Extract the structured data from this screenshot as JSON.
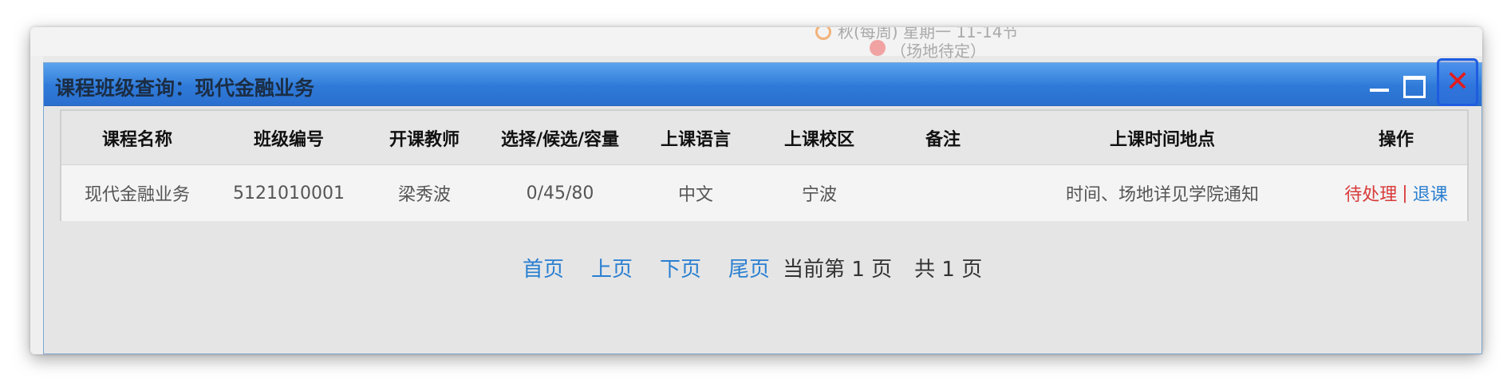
{
  "background": {
    "schedule_text": "秋(每周)  星期一  11-14节",
    "location_text": "（场地待定）"
  },
  "dialog": {
    "title": "课程班级查询：现代金融业务",
    "controls": {
      "minimize": "minimize-icon",
      "maximize": "maximize-icon",
      "close": "✕"
    }
  },
  "table": {
    "headers": [
      "课程名称",
      "班级编号",
      "开课教师",
      "选择/候选/容量",
      "上课语言",
      "上课校区",
      "备注",
      "上课时间地点",
      "操作"
    ],
    "rows": [
      {
        "course_name": "现代金融业务",
        "class_no": "5121010001",
        "teacher": "梁秀波",
        "capacity": "0/45/80",
        "language": "中文",
        "campus": "宁波",
        "note": "",
        "time_place": "时间、场地详见学院通知",
        "op_pending": "待处理",
        "op_sep": "|",
        "op_drop": "退课"
      }
    ]
  },
  "pager": {
    "first": "首页",
    "prev": "上页",
    "next": "下页",
    "last": "尾页",
    "current": "当前第 1 页",
    "total": "共 1 页"
  },
  "colors": {
    "titlebar": "#2f7ad8",
    "link": "#2a7fd1",
    "pending": "#d83a3a",
    "close": "#e31b1b"
  }
}
